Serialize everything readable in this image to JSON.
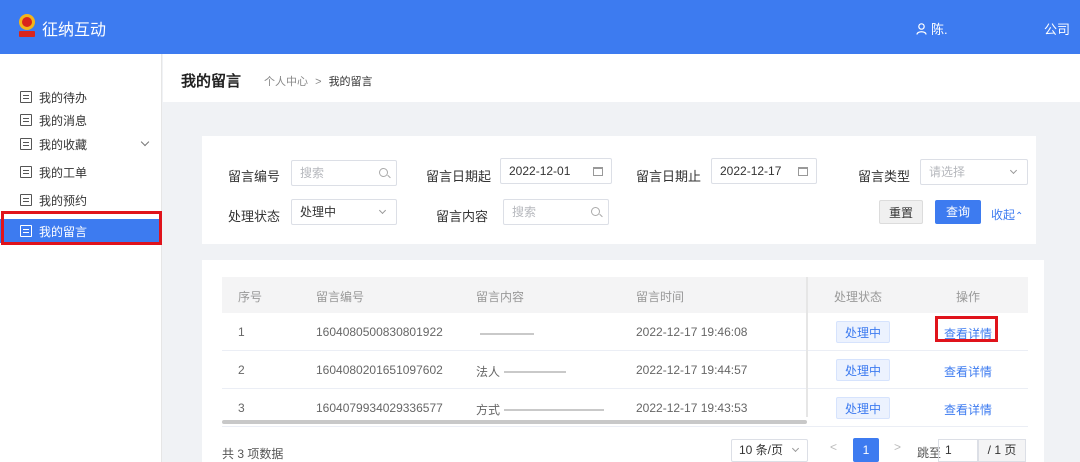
{
  "header": {
    "app_title": "征纳互动",
    "user_name": "陈.",
    "company": "公司",
    "primary_color": "#3d7bf0"
  },
  "sidebar": {
    "items": [
      {
        "label": "我的待办",
        "icon": "document-icon"
      },
      {
        "label": "我的消息",
        "icon": "document-icon"
      },
      {
        "label": "我的收藏",
        "icon": "document-icon",
        "expandable": true
      },
      {
        "label": "我的工单",
        "icon": "document-icon"
      },
      {
        "label": "我的预约",
        "icon": "document-icon"
      },
      {
        "label": "我的留言",
        "icon": "document-icon",
        "active": true
      }
    ]
  },
  "page": {
    "title": "我的留言",
    "breadcrumb_parent": "个人中心",
    "breadcrumb_sep": ">",
    "breadcrumb_current": "我的留言"
  },
  "filters": {
    "msg_no_label": "留言编号",
    "msg_no_placeholder": "搜索",
    "date_from_label": "留言日期起",
    "date_from_value": "2022-12-01",
    "date_to_label": "留言日期止",
    "date_to_value": "2022-12-17",
    "type_label": "留言类型",
    "type_placeholder": "请选择",
    "status_label": "处理状态",
    "status_value": "处理中",
    "content_label": "留言内容",
    "content_placeholder": "搜索",
    "reset_label": "重置",
    "query_label": "查询",
    "collapse_label": "收起"
  },
  "table": {
    "columns": [
      "序号",
      "留言编号",
      "留言内容",
      "留言时间",
      "处理状态",
      "操作"
    ],
    "rows": [
      {
        "index": "1",
        "msg_no": "1604080500830801922",
        "content": "",
        "time": "2022-12-17 19:46:08",
        "status": "处理中",
        "action": "查看详情"
      },
      {
        "index": "2",
        "msg_no": "1604080201651097602",
        "content": "法人",
        "time": "2022-12-17 19:44:57",
        "status": "处理中",
        "action": "查看详情"
      },
      {
        "index": "3",
        "msg_no": "1604079934029336577",
        "content": "方式",
        "time": "2022-12-17 19:43:53",
        "status": "处理中",
        "action": "查看详情"
      }
    ]
  },
  "pagination": {
    "total_text": "共 3 项数据",
    "page_size": "10 条/页",
    "prev": "<",
    "current_page": "1",
    "next": ">",
    "jump_label": "跳至",
    "jump_value": "1",
    "total_pages": "/ 1 页"
  }
}
